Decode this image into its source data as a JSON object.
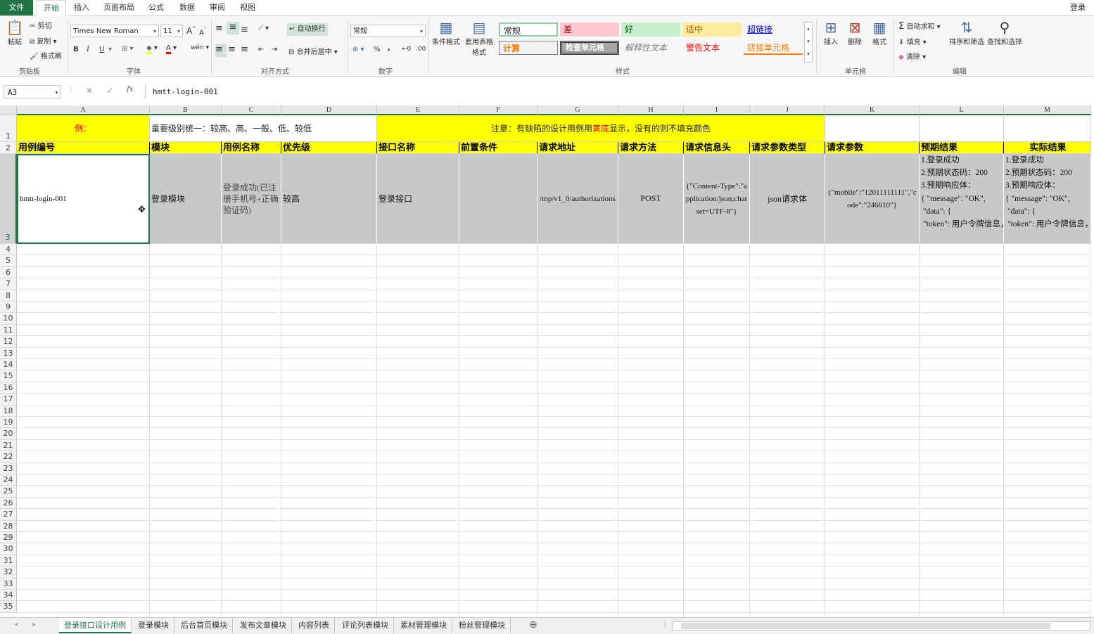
{
  "ribbon_tabs": [
    "文件",
    "开始",
    "插入",
    "页面布局",
    "公式",
    "数据",
    "审阅",
    "视图"
  ],
  "active_tab": "开始",
  "login": "登录",
  "clipboard": {
    "paste": "粘贴",
    "cut": "剪切",
    "copy": "复制",
    "format_painter": "格式刷",
    "label": "剪贴板"
  },
  "font": {
    "name": "Times New Roman",
    "size": "11",
    "bold": "B",
    "italic": "I",
    "underline": "U",
    "label": "字体"
  },
  "alignment": {
    "wrap": "自动换行",
    "merge": "合并后居中",
    "label": "对齐方式"
  },
  "number": {
    "format": "常规",
    "percent": "%",
    "comma": ",",
    "label": "数字"
  },
  "styles": {
    "conditional": "条件格式",
    "table_format": "套用表格格式",
    "normal": "常规",
    "bad": "差",
    "good": "好",
    "neutral": "适中",
    "hyperlink": "超链接",
    "calc": "计算",
    "check": "检查单元格",
    "explain": "解释性文本",
    "warning": "警告文本",
    "linked": "链接单元格",
    "label": "样式"
  },
  "cells_group": {
    "insert": "插入",
    "delete": "删除",
    "format": "格式",
    "label": "单元格"
  },
  "editing": {
    "autosum": "自动求和",
    "fill": "填充",
    "clear": "清除",
    "sort": "排序和筛选",
    "find": "查找和选择",
    "label": "编辑"
  },
  "name_box": "A3",
  "formula": "hmtt-login-001",
  "columns": [
    "A",
    "B",
    "C",
    "D",
    "E",
    "F",
    "G",
    "H",
    "I",
    "J",
    "K",
    "L",
    "M"
  ],
  "rows": [
    "1",
    "2",
    "3",
    "4",
    "5",
    "6",
    "7",
    "8",
    "9",
    "10",
    "11",
    "12",
    "13",
    "14",
    "15",
    "16",
    "17",
    "18",
    "19",
    "20",
    "21",
    "22",
    "23",
    "24",
    "25",
    "26",
    "27",
    "28",
    "29",
    "30",
    "31",
    "32",
    "33",
    "34",
    "35"
  ],
  "row1": {
    "a": "例：",
    "b": "重要级别统一：较高、高、一般、低、较低",
    "note_pre": "注意：有缺陷的设计用例用",
    "note_red": "黄底",
    "note_post": "显示，没有的则不填充颜色"
  },
  "headers": [
    "用例编号",
    "模块",
    "用例名称",
    "优先级",
    "接口名称",
    "前置条件",
    "请求地址",
    "请求方法",
    "请求信息头",
    "请求参数类型",
    "请求参数",
    "预期结果",
    "实际结果"
  ],
  "row3": {
    "id": "hmtt-login-001",
    "module": "登录模块",
    "case_name": "登录成功(已注册手机号+正确验证码)",
    "priority": "较高",
    "api_name": "登录接口",
    "precondition": "",
    "url": "/mp/v1_0/authorizations",
    "method": "POST",
    "headers": "{\"Content-Type\":\"application/json;charset=UTF-8\"}",
    "param_type": "json请求体",
    "params": "{\"mobile\":\"12011111111\",\"code\":\"246810\"}",
    "expected": [
      "1.登录成功",
      "2.预期状态码：200",
      "3.预期响应体：",
      "{ \"message\": \"OK\",",
      " \"data\": {",
      " \"token\": 用户令牌信息，……}}"
    ],
    "actual": [
      "1.登录成功",
      "2.预期状态码：200",
      "3.预期响应体：",
      "{ \"message\": \"OK\",",
      " \"data\": {",
      " \"token\": 用户令牌信息，……}}"
    ]
  },
  "sheets": [
    "登录接口设计用例",
    "登录模块",
    "后台首页模块",
    "发布文章模块",
    "内容列表",
    "评论列表模块",
    "素材管理模块",
    "粉丝管理模块"
  ],
  "active_sheet": "登录接口设计用例",
  "colors": {
    "excel_green": "#217346",
    "yellow": "#ffff00",
    "gray_cell": "#c8c8c8",
    "red_text": "#ff0000"
  }
}
